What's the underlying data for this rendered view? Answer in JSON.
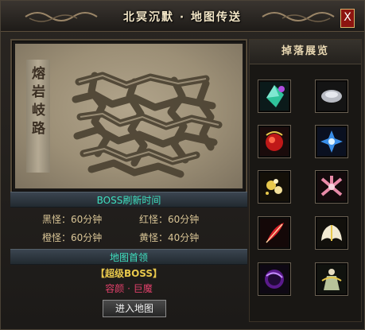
{
  "window": {
    "title": "北冥沉默 · 地图传送",
    "close_label": "X"
  },
  "map": {
    "region_name": "熔岩岐路"
  },
  "boss_refresh": {
    "header": "BOSS刷新时间",
    "rows": [
      {
        "label": "黑怪：",
        "value": "60分钟"
      },
      {
        "label": "红怪：",
        "value": "60分钟"
      },
      {
        "label": "橙怪：",
        "value": "60分钟"
      },
      {
        "label": "黄怪：",
        "value": "40分钟"
      }
    ]
  },
  "leader": {
    "header": "地图首领",
    "boss_title": "【超级BOSS】",
    "boss_name": "容颜 · 巨魔"
  },
  "actions": {
    "enter_label": "进入地图"
  },
  "drops": {
    "header": "掉落展览",
    "items": [
      {
        "icon": "green-gem-icon"
      },
      {
        "icon": "silver-armor-icon"
      },
      {
        "icon": "red-orb-icon"
      },
      {
        "icon": "blue-crystal-icon"
      },
      {
        "icon": "gold-sparkle-icon"
      },
      {
        "icon": "pink-flower-icon"
      },
      {
        "icon": "red-feather-icon"
      },
      {
        "icon": "white-wings-icon"
      },
      {
        "icon": "purple-orb-icon"
      },
      {
        "icon": "gold-figure-icon"
      }
    ]
  },
  "colors": {
    "cyan": "#3fe0c0",
    "gold": "#d9c596",
    "leader_gold": "#e8c84c",
    "boss_red": "#e0406a"
  }
}
